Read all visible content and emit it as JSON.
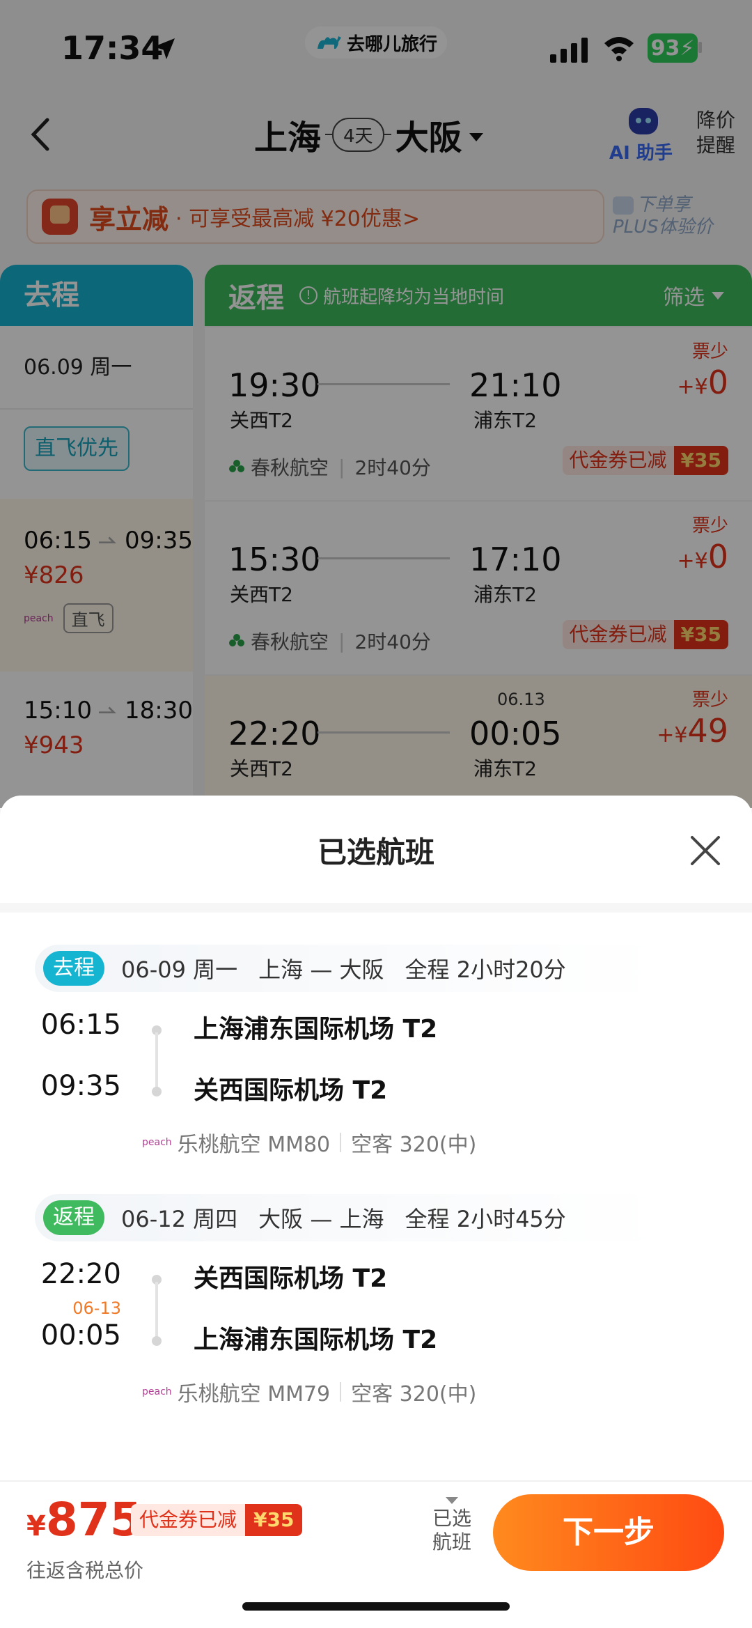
{
  "status": {
    "time": "17:34",
    "app": "去哪儿旅行",
    "battery": "93"
  },
  "header": {
    "from_city": "上海",
    "days": "4天",
    "to_city": "大阪",
    "ai_label": "AI 助手",
    "price_alert_line1": "降价",
    "price_alert_line2": "提醒"
  },
  "promo": {
    "strong": "享立减",
    "text": "· 可享受最高减 ¥20优惠>",
    "plus_line1": "下单享",
    "plus_line2": "PLUS体验价"
  },
  "outbound_col": {
    "title": "去程",
    "date": "06.09 周一",
    "direct_priority": "直飞优先",
    "selected": {
      "dep": "06:15",
      "arr": "09:35",
      "price": "¥826",
      "airline_logo": "peach",
      "tag": "直飞"
    },
    "next": {
      "dep": "15:10",
      "arr": "18:30",
      "price": "¥943"
    }
  },
  "return_col": {
    "title": "返程",
    "note": "航班起降均为当地时间",
    "filter": "筛选",
    "flights": [
      {
        "dep": "19:30",
        "dep_apt": "关西T2",
        "arr": "21:10",
        "arr_apt": "浦东T2",
        "scarce": "票少",
        "delta_prefix": "+¥",
        "delta": "0",
        "airline": "春秋航空",
        "duration": "2时40分",
        "voucher_label": "代金券已减",
        "voucher_amt": "¥35"
      },
      {
        "dep": "15:30",
        "dep_apt": "关西T2",
        "arr": "17:10",
        "arr_apt": "浦东T2",
        "scarce": "票少",
        "delta_prefix": "+¥",
        "delta": "0",
        "airline": "春秋航空",
        "duration": "2时40分",
        "voucher_label": "代金券已减",
        "voucher_amt": "¥35"
      },
      {
        "dep": "22:20",
        "dep_apt": "关西T2",
        "arr": "00:05",
        "arr_apt": "浦东T2",
        "next_day": "06.13",
        "scarce": "票少",
        "delta_prefix": "+¥",
        "delta": "49"
      }
    ]
  },
  "sheet": {
    "title": "已选航班",
    "segments": [
      {
        "tag": "去程",
        "date": "06-09 周一",
        "route": "上海 — 大阪",
        "total": "全程 2小时20分",
        "dep_time": "06:15",
        "dep_airport": "上海浦东国际机场 T2",
        "arr_time": "09:35",
        "arr_airport": "关西国际机场 T2",
        "airline_logo": "peach",
        "flight": "乐桃航空 MM80",
        "aircraft": "空客 320(中)"
      },
      {
        "tag": "返程",
        "date": "06-12 周四",
        "route": "大阪 — 上海",
        "total": "全程 2小时45分",
        "dep_time": "22:20",
        "dep_airport": "关西国际机场 T2",
        "arr_date": "06-13",
        "arr_time": "00:05",
        "arr_airport": "上海浦东国际机场 T2",
        "airline_logo": "peach",
        "flight": "乐桃航空 MM79",
        "aircraft": "空客 320(中)"
      }
    ]
  },
  "footer": {
    "currency": "¥",
    "total": "875",
    "voucher_label": "代金券已减",
    "voucher_amt": "¥35",
    "total_note": "往返含税总价",
    "selected_line1": "已选",
    "selected_line2": "航班",
    "next": "下一步"
  },
  "colors": {
    "outbound": "#15b4d0",
    "return": "#3fba5e",
    "price": "#e0321a",
    "cta": "#ff5a14"
  }
}
